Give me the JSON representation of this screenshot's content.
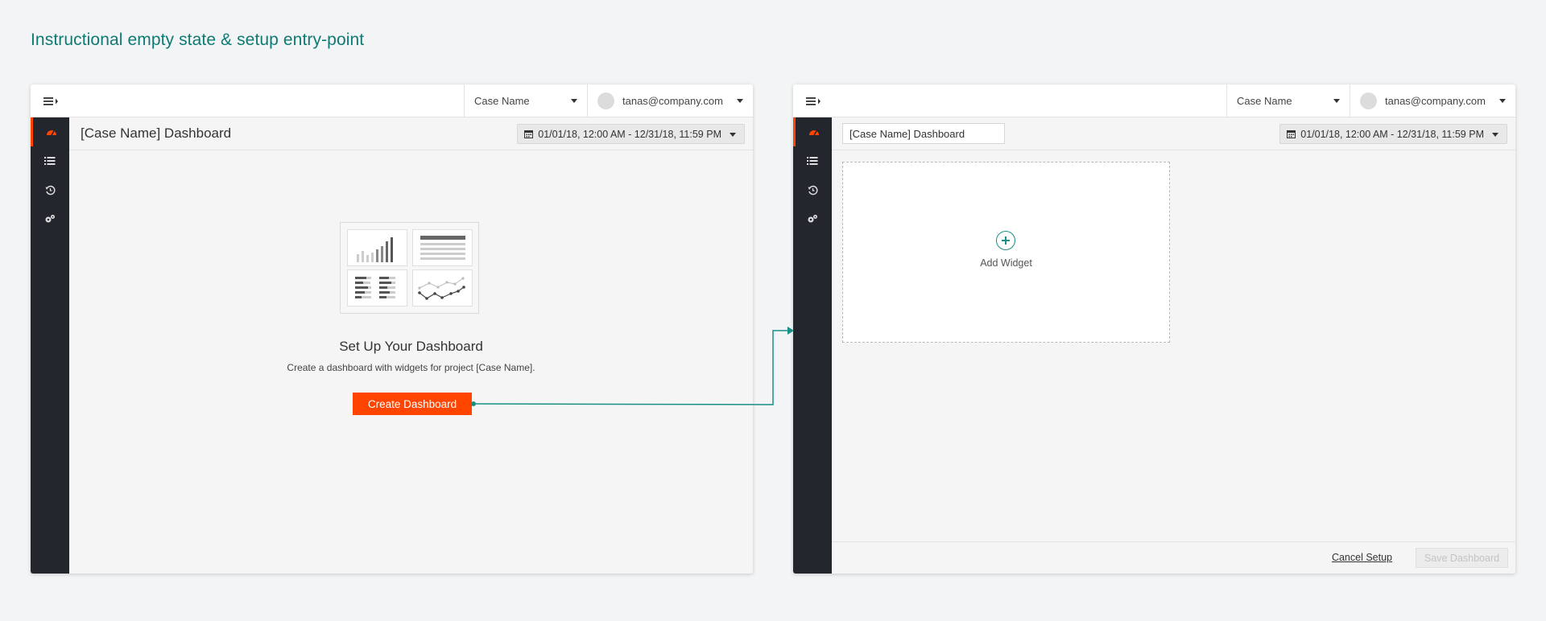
{
  "heading": "Instructional empty state & setup entry-point",
  "colors": {
    "accent": "#ff4500",
    "teal": "#0f7a74",
    "sidebar": "#23262d"
  },
  "left_screen": {
    "case_select": "Case Name",
    "user_email": "tanas@company.com",
    "dashboard_title": "[Case Name] Dashboard",
    "date_range": "01/01/18, 12:00 AM - 12/31/18, 11:59 PM",
    "empty_state": {
      "title": "Set Up Your Dashboard",
      "description": "Create a dashboard with widgets for project [Case Name].",
      "button": "Create Dashboard"
    },
    "sidebar_icons": [
      "speedometer-icon",
      "list-icon",
      "history-icon",
      "settings-icon"
    ]
  },
  "right_screen": {
    "case_select": "Case Name",
    "user_email": "tanas@company.com",
    "dashboard_title_value": "[Case Name] Dashboard",
    "date_range": "01/01/18, 12:00 AM - 12/31/18, 11:59 PM",
    "add_widget": "Add Widget",
    "cancel": "Cancel Setup",
    "save": "Save Dashboard",
    "sidebar_icons": [
      "speedometer-icon",
      "list-icon",
      "history-icon",
      "settings-icon"
    ]
  }
}
